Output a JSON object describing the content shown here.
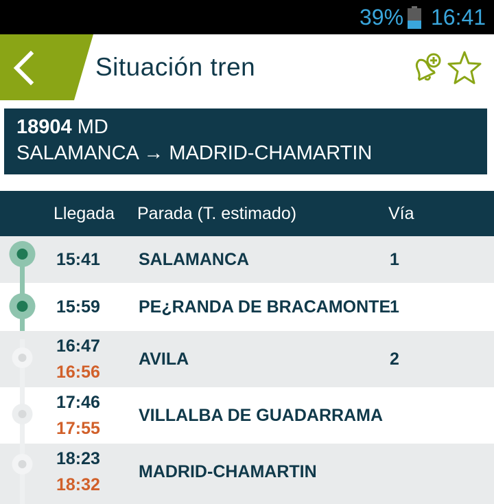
{
  "status_bar": {
    "battery_percent": "39%",
    "battery_level": 0.39,
    "time": "16:41"
  },
  "header": {
    "title": "Situación tren",
    "back_icon": "chevron-left-icon",
    "alert_icon": "bell-plus-icon",
    "favorite_icon": "star-outline-icon",
    "accent_color": "#8aa516"
  },
  "train": {
    "number": "18904",
    "type": "MD",
    "origin": "SALAMANCA",
    "arrow": "→",
    "destination": "MADRID-CHAMARTIN"
  },
  "table": {
    "col_arrival": "Llegada",
    "col_stop": "Parada (T. estimado)",
    "col_track": "Vía"
  },
  "stops": [
    {
      "scheduled": "15:41",
      "estimated": "",
      "name": "SALAMANCA",
      "track": "1",
      "passed": true
    },
    {
      "scheduled": "15:59",
      "estimated": "",
      "name": "PE¿RANDA DE BRACAMONTE",
      "track": "1",
      "passed": true
    },
    {
      "scheduled": "16:47",
      "estimated": "16:56",
      "name": "AVILA",
      "track": "2",
      "passed": false
    },
    {
      "scheduled": "17:46",
      "estimated": "17:55",
      "name": "VILLALBA DE GUADARRAMA",
      "track": "",
      "passed": false
    },
    {
      "scheduled": "18:23",
      "estimated": "18:32",
      "name": "MADRID-CHAMARTIN",
      "track": "",
      "passed": false
    }
  ],
  "colors": {
    "navy": "#10394a",
    "delay_orange": "#d1602a",
    "passed_green": "#1f7a55",
    "passed_ring": "#8fc4ae",
    "status_blue": "#3aa6dc"
  }
}
